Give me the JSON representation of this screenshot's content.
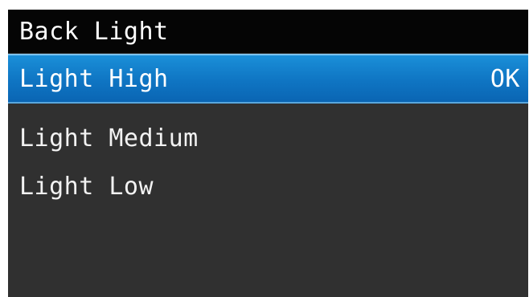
{
  "screen": {
    "title": "Back Light",
    "items": [
      {
        "label": "Light High",
        "selected": true,
        "status": "OK"
      },
      {
        "label": "Light Medium",
        "selected": false,
        "status": ""
      },
      {
        "label": "Light Low",
        "selected": false,
        "status": ""
      }
    ]
  },
  "colors": {
    "title_bar": "#050505",
    "background": "#303030",
    "selection": "#0f75c3",
    "text": "#ffffff"
  }
}
